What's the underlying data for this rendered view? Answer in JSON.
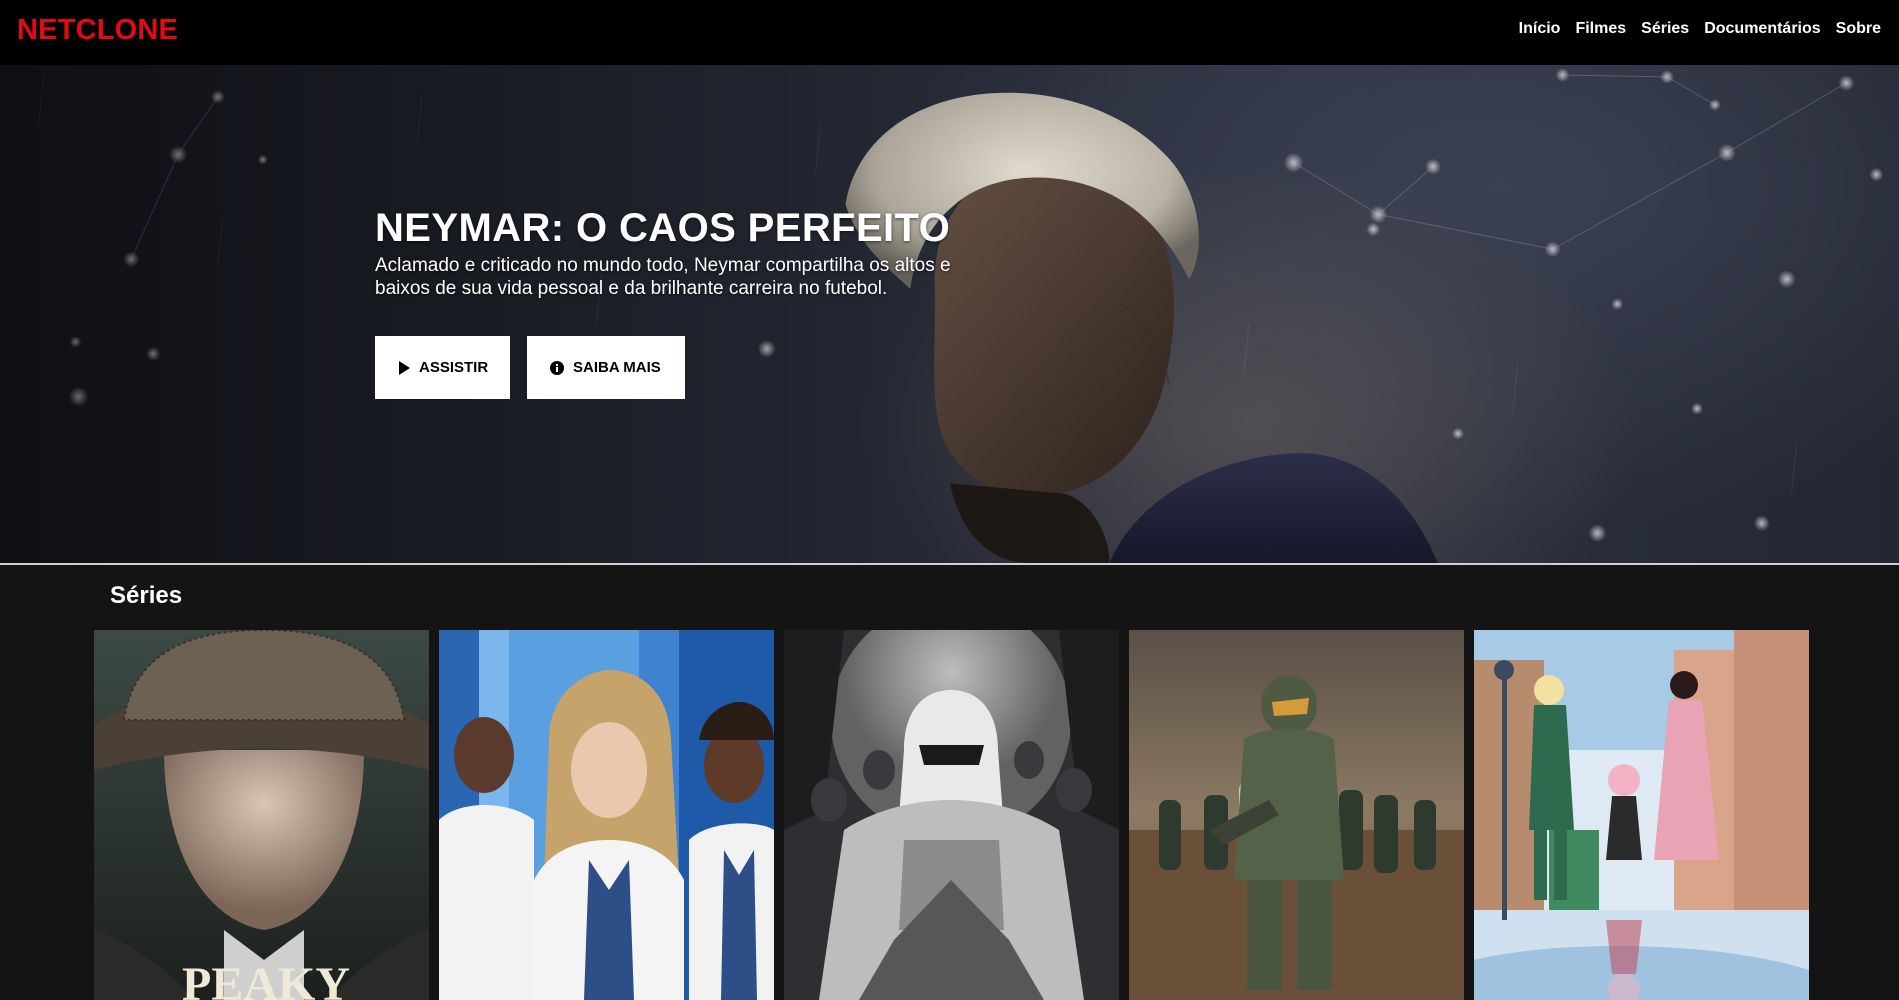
{
  "header": {
    "logo": "NETCLONE",
    "nav": [
      {
        "label": "Início"
      },
      {
        "label": "Filmes"
      },
      {
        "label": "Séries"
      },
      {
        "label": "Documentários"
      },
      {
        "label": "Sobre"
      }
    ]
  },
  "hero": {
    "title": "NEYMAR: O CAOS PERFEITO",
    "description": "Aclamado e criticado no mundo todo, Neymar compartilha os altos e baixos de sua vida pessoal e da brilhante carreira no futebol.",
    "buttons": {
      "watch_label": "ASSISTIR",
      "watch_icon": "play-icon",
      "info_label": "SAIBA MAIS",
      "info_icon": "info-icon"
    }
  },
  "rows": [
    {
      "title": "Séries",
      "posters": [
        {
          "image": "peaky-blinders-poster",
          "visible_text": "PEAKY"
        },
        {
          "image": "greys-anatomy-poster"
        },
        {
          "image": "moon-knight-poster"
        },
        {
          "image": "halo-poster"
        },
        {
          "image": "spy-family-poster"
        }
      ]
    }
  ],
  "colors": {
    "brand": "#e50914",
    "header_bg": "#000000",
    "page_bg": "#141414",
    "button_bg": "#ffffff"
  }
}
